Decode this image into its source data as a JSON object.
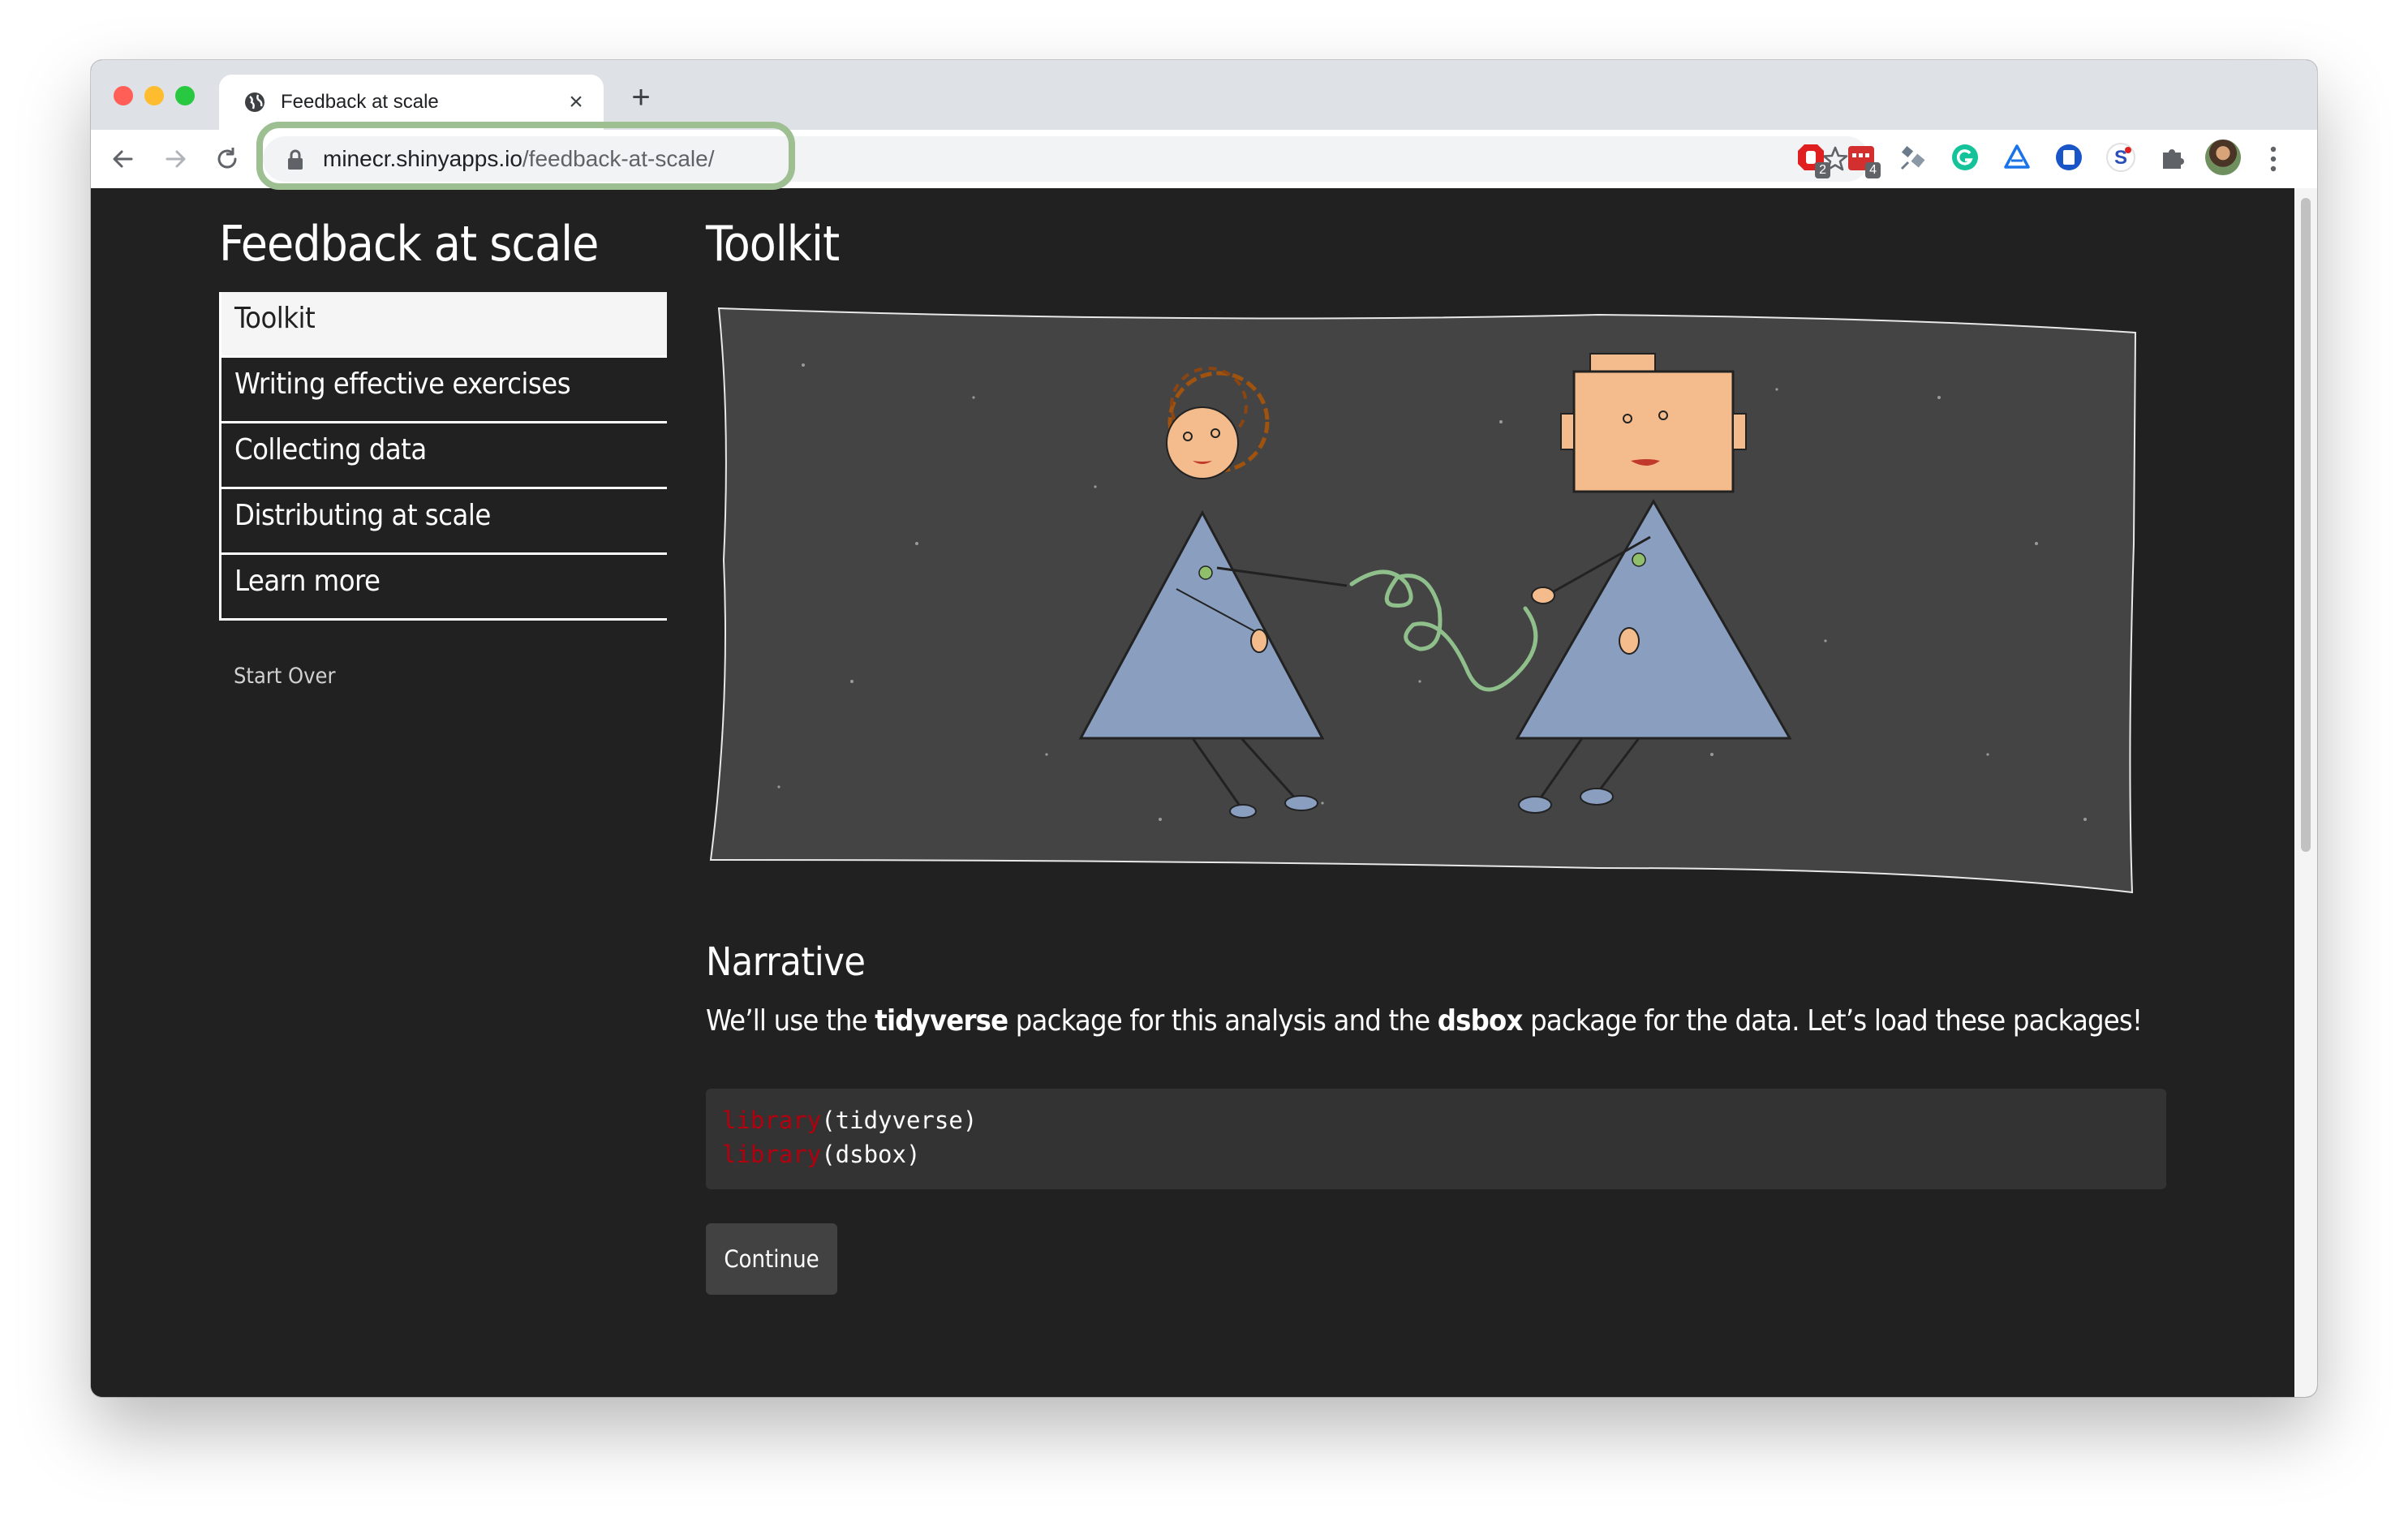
{
  "browser": {
    "tab_title": "Feedback at scale",
    "url_host": "minecr.shinyapps.io",
    "url_path": "/feedback-at-scale/",
    "extensions": [
      {
        "icon": "adblock-icon",
        "badge": "2"
      },
      {
        "icon": "calendar-extension-icon",
        "badge": "4"
      },
      {
        "icon": "satellite-extension-icon",
        "badge": ""
      },
      {
        "icon": "grammarly-icon",
        "badge": ""
      },
      {
        "icon": "google-drive-icon",
        "badge": ""
      },
      {
        "icon": "document-extension-icon",
        "badge": ""
      },
      {
        "icon": "s-extension-icon",
        "badge": ""
      },
      {
        "icon": "puzzle-icon",
        "badge": ""
      }
    ]
  },
  "sidebar": {
    "title": "Feedback at scale",
    "items": [
      {
        "label": "Toolkit",
        "active": true
      },
      {
        "label": "Writing effective exercises",
        "active": false
      },
      {
        "label": "Collecting data",
        "active": false
      },
      {
        "label": "Distributing at scale",
        "active": false
      },
      {
        "label": "Learn more",
        "active": false
      }
    ],
    "start_over": "Start Over"
  },
  "main": {
    "title": "Toolkit",
    "narrative_heading": "Narrative",
    "para": {
      "t1": "We’ll use the ",
      "b1": "tidyverse",
      "t2": " package for this analysis and the ",
      "b2": "dsbox",
      "t3": " package for the data. Let’s load these packages!"
    },
    "code": [
      {
        "fn": "library",
        "arg": "(tidyverse)"
      },
      {
        "fn": "library",
        "arg": "(dsbox)"
      }
    ],
    "continue_label": "Continue"
  },
  "colors": {
    "page_bg": "#212121",
    "code_bg": "#333333",
    "code_keyword": "#b3000f",
    "button_bg": "#424242",
    "url_highlight": "#9dbf92"
  }
}
